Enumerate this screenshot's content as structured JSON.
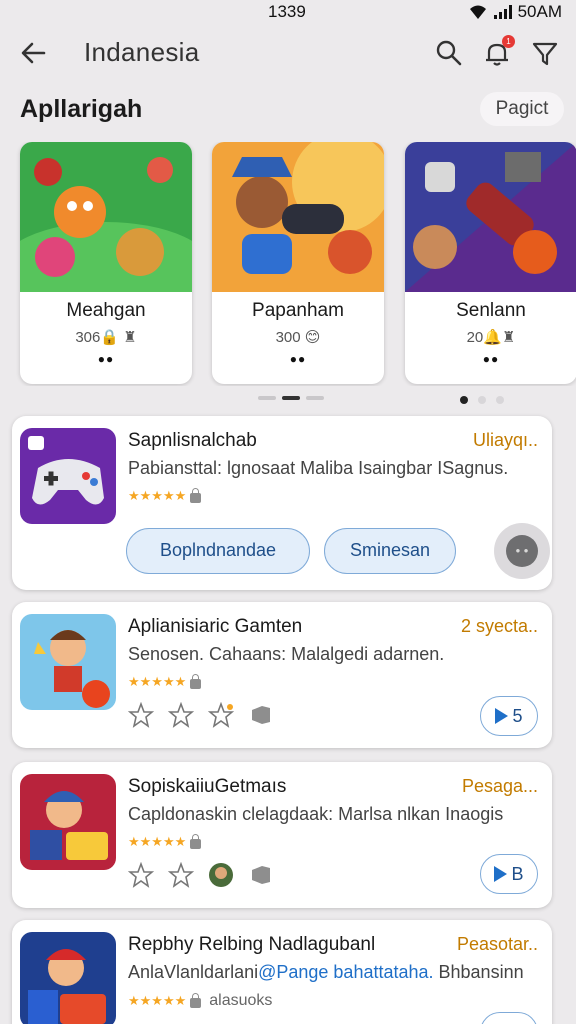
{
  "status": {
    "time": "1339",
    "clock": "50AM"
  },
  "appbar": {
    "title": "Indanesia"
  },
  "section": {
    "title": "Apllarigah",
    "chip": "Pagict"
  },
  "carousel": [
    {
      "name": "Meahgan",
      "meta": "306🔒 ♜",
      "dots": "●●"
    },
    {
      "name": "Papanham",
      "meta": "300 😊",
      "dots": "●●"
    },
    {
      "name": "Senlann",
      "meta": "20🔔♜",
      "dots": "●●"
    }
  ],
  "items": [
    {
      "title": "Sapnlisnalchab",
      "right": "Uliayqı..",
      "desc": "Pabiansttal: lgnosaat Maliba Isaingbar  ISagnus.",
      "stars": "★★★★★",
      "buttons": [
        "Boplndnandae",
        "Sminesan"
      ]
    },
    {
      "title": "Aplianisiaric Gamten",
      "right": "2 syecta..",
      "desc": "Senosen. Cahaans: Malalgedi adarnen.",
      "stars": "★★★★★",
      "action": "5"
    },
    {
      "title": "SopiskaiiuGetmaıs",
      "right": "Pesaga...",
      "desc": "Capldonaskin clelagdaak: Marlsa nlkan Inaogis",
      "stars": "★★★★★",
      "action": "B"
    },
    {
      "title": "Repbhy Relbing Nadlagubanl",
      "right": "Peasotar..",
      "desc_a": "AnlaVlanldarlani",
      "desc_b": "@Pange bahattataha.",
      "desc_c": " Bhbansinn",
      "stars": "★★★★★",
      "extra": "alasuoks"
    }
  ]
}
